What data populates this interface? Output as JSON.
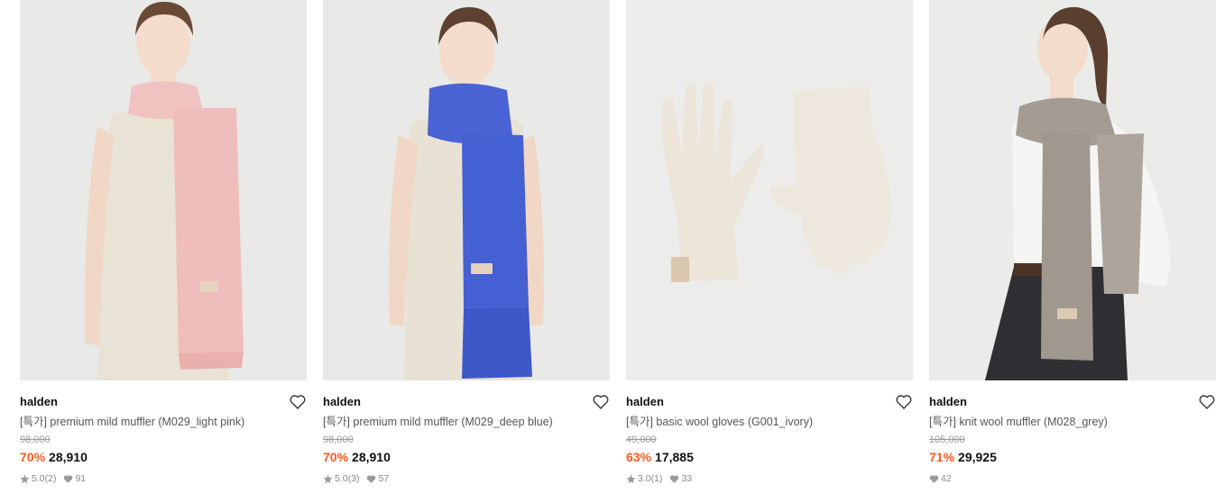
{
  "products": [
    {
      "brand": "halden",
      "title": "[특가] premium mild muffler (M029_light pink)",
      "original_price": "98,000",
      "discount": "70%",
      "price": "28,910",
      "rating": "5.0",
      "review_count": "(2)",
      "likes": "91",
      "image": "model-pink-scarf",
      "colors": {
        "bg": "#e9e9e7",
        "item": "#f0c2c0"
      }
    },
    {
      "brand": "halden",
      "title": "[특가] premium mild muffler (M029_deep blue)",
      "original_price": "98,000",
      "discount": "70%",
      "price": "28,910",
      "rating": "5.0",
      "review_count": "(3)",
      "likes": "57",
      "image": "model-blue-scarf",
      "colors": {
        "bg": "#e9e9e7",
        "item": "#4a63d4"
      }
    },
    {
      "brand": "halden",
      "title": "[특가] basic wool gloves (G001_ivory)",
      "original_price": "49,000",
      "discount": "63%",
      "price": "17,885",
      "rating": "3.0",
      "review_count": "(1)",
      "likes": "33",
      "image": "ivory-gloves",
      "colors": {
        "bg": "#ececeb",
        "item": "#eee6dc"
      }
    },
    {
      "brand": "halden",
      "title": "[특가] knit wool muffler (M028_grey)",
      "original_price": "105,000",
      "discount": "71%",
      "price": "29,925",
      "rating": null,
      "review_count": null,
      "likes": "42",
      "image": "model-grey-scarf",
      "colors": {
        "bg": "#ebebea",
        "item": "#a49c93"
      }
    }
  ],
  "icons": {
    "wishlist": "heart-outline-icon",
    "rating": "star-icon",
    "likes": "heart-filled-icon"
  },
  "accent": {
    "discount": "#ff5a1f"
  }
}
